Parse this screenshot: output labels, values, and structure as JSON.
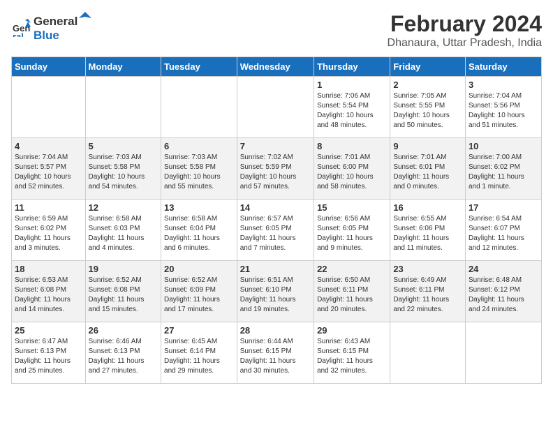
{
  "logo": {
    "general": "General",
    "blue": "Blue"
  },
  "title": {
    "month_year": "February 2024",
    "location": "Dhanaura, Uttar Pradesh, India"
  },
  "weekdays": [
    "Sunday",
    "Monday",
    "Tuesday",
    "Wednesday",
    "Thursday",
    "Friday",
    "Saturday"
  ],
  "weeks": [
    [
      {
        "day": "",
        "info": ""
      },
      {
        "day": "",
        "info": ""
      },
      {
        "day": "",
        "info": ""
      },
      {
        "day": "",
        "info": ""
      },
      {
        "day": "1",
        "info": "Sunrise: 7:06 AM\nSunset: 5:54 PM\nDaylight: 10 hours\nand 48 minutes."
      },
      {
        "day": "2",
        "info": "Sunrise: 7:05 AM\nSunset: 5:55 PM\nDaylight: 10 hours\nand 50 minutes."
      },
      {
        "day": "3",
        "info": "Sunrise: 7:04 AM\nSunset: 5:56 PM\nDaylight: 10 hours\nand 51 minutes."
      }
    ],
    [
      {
        "day": "4",
        "info": "Sunrise: 7:04 AM\nSunset: 5:57 PM\nDaylight: 10 hours\nand 52 minutes."
      },
      {
        "day": "5",
        "info": "Sunrise: 7:03 AM\nSunset: 5:58 PM\nDaylight: 10 hours\nand 54 minutes."
      },
      {
        "day": "6",
        "info": "Sunrise: 7:03 AM\nSunset: 5:58 PM\nDaylight: 10 hours\nand 55 minutes."
      },
      {
        "day": "7",
        "info": "Sunrise: 7:02 AM\nSunset: 5:59 PM\nDaylight: 10 hours\nand 57 minutes."
      },
      {
        "day": "8",
        "info": "Sunrise: 7:01 AM\nSunset: 6:00 PM\nDaylight: 10 hours\nand 58 minutes."
      },
      {
        "day": "9",
        "info": "Sunrise: 7:01 AM\nSunset: 6:01 PM\nDaylight: 11 hours\nand 0 minutes."
      },
      {
        "day": "10",
        "info": "Sunrise: 7:00 AM\nSunset: 6:02 PM\nDaylight: 11 hours\nand 1 minute."
      }
    ],
    [
      {
        "day": "11",
        "info": "Sunrise: 6:59 AM\nSunset: 6:02 PM\nDaylight: 11 hours\nand 3 minutes."
      },
      {
        "day": "12",
        "info": "Sunrise: 6:58 AM\nSunset: 6:03 PM\nDaylight: 11 hours\nand 4 minutes."
      },
      {
        "day": "13",
        "info": "Sunrise: 6:58 AM\nSunset: 6:04 PM\nDaylight: 11 hours\nand 6 minutes."
      },
      {
        "day": "14",
        "info": "Sunrise: 6:57 AM\nSunset: 6:05 PM\nDaylight: 11 hours\nand 7 minutes."
      },
      {
        "day": "15",
        "info": "Sunrise: 6:56 AM\nSunset: 6:05 PM\nDaylight: 11 hours\nand 9 minutes."
      },
      {
        "day": "16",
        "info": "Sunrise: 6:55 AM\nSunset: 6:06 PM\nDaylight: 11 hours\nand 11 minutes."
      },
      {
        "day": "17",
        "info": "Sunrise: 6:54 AM\nSunset: 6:07 PM\nDaylight: 11 hours\nand 12 minutes."
      }
    ],
    [
      {
        "day": "18",
        "info": "Sunrise: 6:53 AM\nSunset: 6:08 PM\nDaylight: 11 hours\nand 14 minutes."
      },
      {
        "day": "19",
        "info": "Sunrise: 6:52 AM\nSunset: 6:08 PM\nDaylight: 11 hours\nand 15 minutes."
      },
      {
        "day": "20",
        "info": "Sunrise: 6:52 AM\nSunset: 6:09 PM\nDaylight: 11 hours\nand 17 minutes."
      },
      {
        "day": "21",
        "info": "Sunrise: 6:51 AM\nSunset: 6:10 PM\nDaylight: 11 hours\nand 19 minutes."
      },
      {
        "day": "22",
        "info": "Sunrise: 6:50 AM\nSunset: 6:11 PM\nDaylight: 11 hours\nand 20 minutes."
      },
      {
        "day": "23",
        "info": "Sunrise: 6:49 AM\nSunset: 6:11 PM\nDaylight: 11 hours\nand 22 minutes."
      },
      {
        "day": "24",
        "info": "Sunrise: 6:48 AM\nSunset: 6:12 PM\nDaylight: 11 hours\nand 24 minutes."
      }
    ],
    [
      {
        "day": "25",
        "info": "Sunrise: 6:47 AM\nSunset: 6:13 PM\nDaylight: 11 hours\nand 25 minutes."
      },
      {
        "day": "26",
        "info": "Sunrise: 6:46 AM\nSunset: 6:13 PM\nDaylight: 11 hours\nand 27 minutes."
      },
      {
        "day": "27",
        "info": "Sunrise: 6:45 AM\nSunset: 6:14 PM\nDaylight: 11 hours\nand 29 minutes."
      },
      {
        "day": "28",
        "info": "Sunrise: 6:44 AM\nSunset: 6:15 PM\nDaylight: 11 hours\nand 30 minutes."
      },
      {
        "day": "29",
        "info": "Sunrise: 6:43 AM\nSunset: 6:15 PM\nDaylight: 11 hours\nand 32 minutes."
      },
      {
        "day": "",
        "info": ""
      },
      {
        "day": "",
        "info": ""
      }
    ]
  ]
}
